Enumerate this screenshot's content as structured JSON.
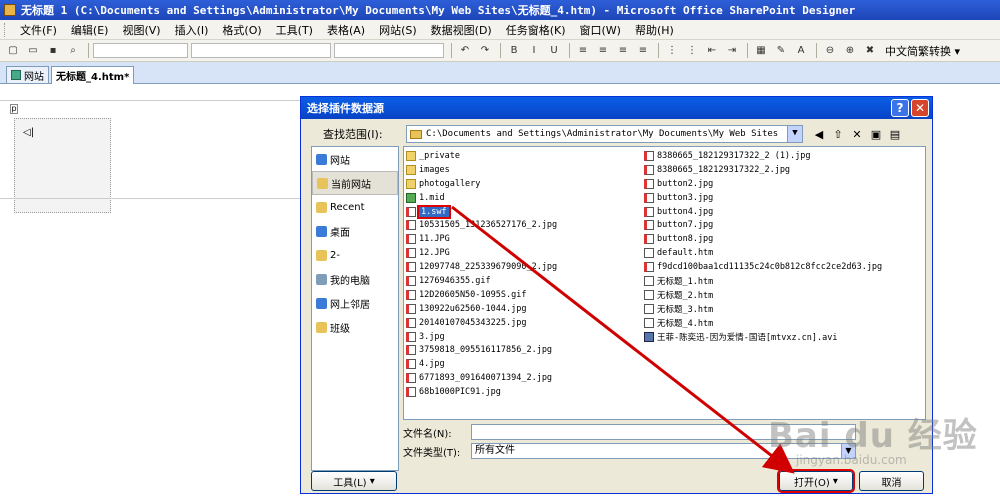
{
  "window": {
    "title": "无标题 1 (C:\\Documents and Settings\\Administrator\\My Documents\\My Web Sites\\无标题_4.htm) - Microsoft Office SharePoint Designer"
  },
  "menu": [
    "文件(F)",
    "编辑(E)",
    "视图(V)",
    "插入(I)",
    "格式(O)",
    "工具(T)",
    "表格(A)",
    "网站(S)",
    "数据视图(D)",
    "任务窗格(K)",
    "窗口(W)",
    "帮助(H)"
  ],
  "toolbar": {
    "convert_label": "中文简繁转换 ▾"
  },
  "tabs": [
    {
      "label": "网站"
    },
    {
      "label": "无标题_4.htm*"
    }
  ],
  "editor": {
    "p_tag": "p",
    "plugin_glyph": "◁|"
  },
  "dialog": {
    "title": "选择插件数据源",
    "lookin_label": "查找范围(I):",
    "lookin_path": "C:\\Documents and Settings\\Administrator\\My Documents\\My Web Sites",
    "places": [
      {
        "label": "网站",
        "color": "#3b7bd8"
      },
      {
        "label": "当前网站",
        "color": "#e8c35a"
      },
      {
        "label": "Recent",
        "color": "#e8c35a"
      },
      {
        "label": "桌面",
        "color": "#3b7bd8"
      },
      {
        "label": "2-",
        "color": "#e8c35a"
      },
      {
        "label": "我的电脑",
        "color": "#7f9db9"
      },
      {
        "label": "网上邻居",
        "color": "#3b7bd8"
      },
      {
        "label": "班级",
        "color": "#e8c35a"
      }
    ],
    "files_col1": [
      {
        "name": "_private",
        "type": "folder"
      },
      {
        "name": "images",
        "type": "folder"
      },
      {
        "name": "photogallery",
        "type": "folder"
      },
      {
        "name": "1.mid",
        "type": "mid"
      },
      {
        "name": "1.swf",
        "type": "img",
        "highlight": true
      },
      {
        "name": "10531505_131236527176_2.jpg",
        "type": "img"
      },
      {
        "name": "11.JPG",
        "type": "img"
      },
      {
        "name": "12.JPG",
        "type": "img"
      },
      {
        "name": "12097748_225339679090_2.jpg",
        "type": "img"
      },
      {
        "name": "1276946355.gif",
        "type": "img"
      },
      {
        "name": "12D20605N50-1095S.gif",
        "type": "img"
      },
      {
        "name": "130922u62560-1044.jpg",
        "type": "img"
      },
      {
        "name": "20140107045343225.jpg",
        "type": "img"
      },
      {
        "name": "3.jpg",
        "type": "img"
      },
      {
        "name": "3759818_095516117856_2.jpg",
        "type": "img"
      },
      {
        "name": "4.jpg",
        "type": "img"
      },
      {
        "name": "6771893_091640071394_2.jpg",
        "type": "img"
      },
      {
        "name": "68b1000PIC91.jpg",
        "type": "img"
      }
    ],
    "files_col2": [
      {
        "name": "8380665_182129317322_2 (1).jpg",
        "type": "img"
      },
      {
        "name": "8380665_182129317322_2.jpg",
        "type": "img"
      },
      {
        "name": "button2.jpg",
        "type": "img"
      },
      {
        "name": "button3.jpg",
        "type": "img"
      },
      {
        "name": "button4.jpg",
        "type": "img"
      },
      {
        "name": "button7.jpg",
        "type": "img"
      },
      {
        "name": "button8.jpg",
        "type": "img"
      },
      {
        "name": "default.htm",
        "type": "htm"
      },
      {
        "name": "f9dcd100baa1cd11135c24c0b812c8fcc2ce2d63.jpg",
        "type": "img"
      },
      {
        "name": "无标题_1.htm",
        "type": "htm"
      },
      {
        "name": "无标题_2.htm",
        "type": "htm"
      },
      {
        "name": "无标题_3.htm",
        "type": "htm"
      },
      {
        "name": "无标题_4.htm",
        "type": "htm"
      },
      {
        "name": "王菲-陈奕迅-因为爱情-国语[mtvxz.cn].avi",
        "type": "avi"
      }
    ],
    "filename_label": "文件名(N):",
    "filename_value": "",
    "filetype_label": "文件类型(T):",
    "filetype_value": "所有文件",
    "tools_label": "工具(L)",
    "open_label": "打开(O)",
    "cancel_label": "取消"
  },
  "watermark": {
    "big": "Bai du 经验",
    "small": "jingyan.baidu.com"
  },
  "colors": {
    "annotation": "#d00000",
    "selection": "#316ac5"
  }
}
